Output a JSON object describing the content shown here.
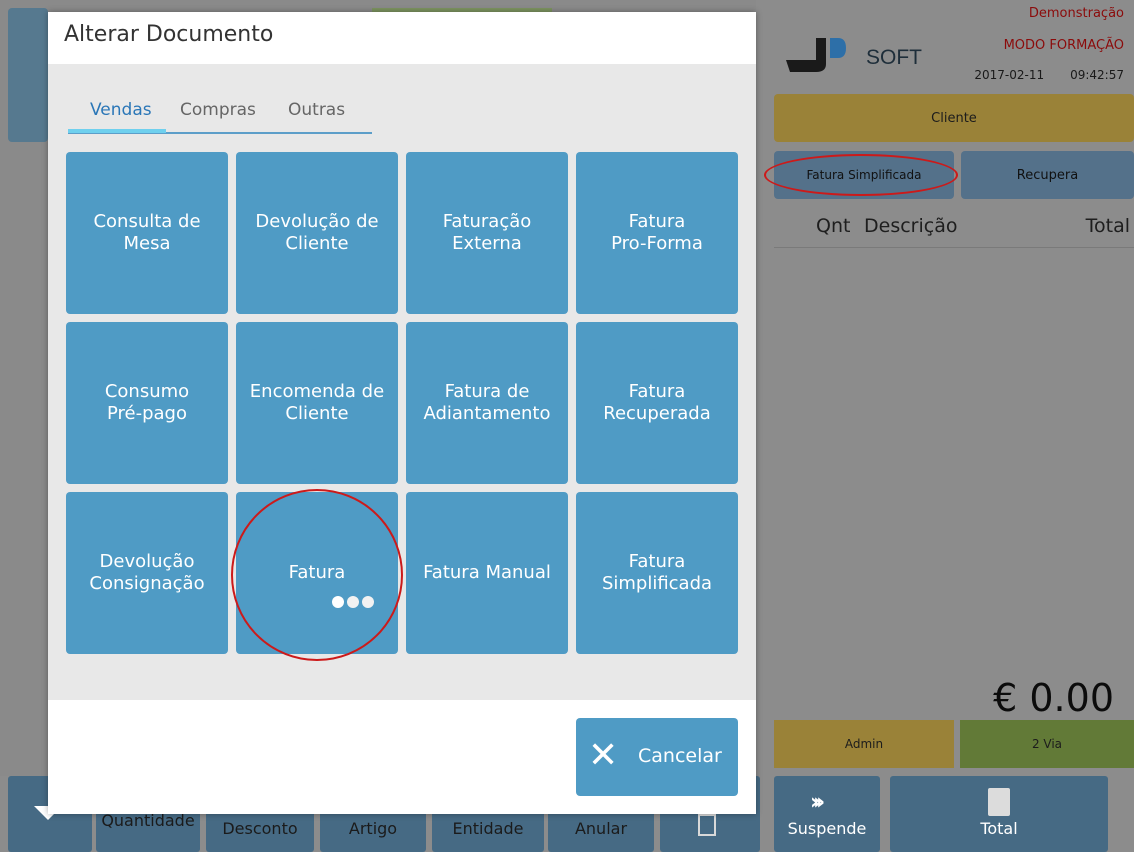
{
  "header": {
    "logo_text": "SOFT",
    "demo_label": "Demonstração",
    "mode_label": "MODO FORMAÇÃO",
    "date": "2017-02-11",
    "time": "09:42:57"
  },
  "right_panel": {
    "client_button": "Cliente",
    "doc_type_button": "Fatura Simplificada",
    "recover_button": "Recupera",
    "columns": [
      "Qnt",
      "Descrição",
      "Total"
    ],
    "grand_total": "€ 0.00",
    "admin_button": "Admin",
    "second_copy_button": "2 Via"
  },
  "bottom_bar": {
    "quantidade": "Quantidade",
    "desconto": "Desconto",
    "artigo": "Artigo",
    "entidade": "Entidade",
    "anular": "Anular",
    "suspende": "Suspende",
    "total": "Total"
  },
  "dialog": {
    "title": "Alterar Documento",
    "tabs": [
      "Vendas",
      "Compras",
      "Outras"
    ],
    "active_tab": "Vendas",
    "tiles": [
      "Consulta de\nMesa",
      "Devolução de\nCliente",
      "Faturação\nExterna",
      "Fatura\nPro-Forma",
      "Consumo\nPré-pago",
      "Encomenda de\nCliente",
      "Fatura de\nAdiantamento",
      "Fatura\nRecuperada",
      "Devolução\nConsignação",
      "Fatura",
      "Fatura Manual",
      "Fatura\nSimplificada"
    ],
    "page_count": 3,
    "current_page": 1,
    "cancel_button": "Cancelar"
  },
  "annotations": {
    "color": "#cc1a1a"
  }
}
